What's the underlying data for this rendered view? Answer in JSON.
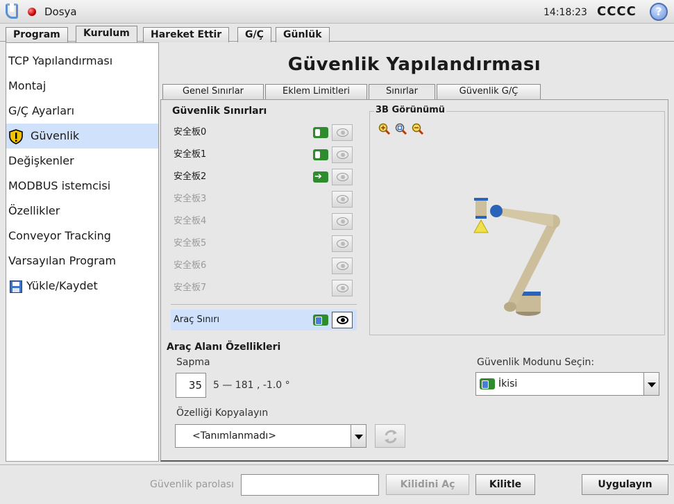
{
  "topbar": {
    "file_menu": "Dosya",
    "time": "14:18:23",
    "robot_name": "CCCC",
    "help": "?"
  },
  "main_tabs": [
    "Program",
    "Kurulum",
    "Hareket Ettir",
    "G/Ç",
    "Günlük"
  ],
  "sidebar": {
    "items": [
      {
        "label": "TCP Yapılandırması"
      },
      {
        "label": "Montaj"
      },
      {
        "label": "G/Ç Ayarları"
      },
      {
        "label": "Güvenlik"
      },
      {
        "label": "Değişkenler"
      },
      {
        "label": "MODBUS istemcisi"
      },
      {
        "label": "Özellikler"
      },
      {
        "label": "Conveyor Tracking"
      },
      {
        "label": "Varsayılan Program"
      },
      {
        "label": "Yükle/Kaydet"
      }
    ]
  },
  "page": {
    "title": "Güvenlik Yapılandırması",
    "sub_tabs": [
      "Genel Sınırlar",
      "Eklem Limitleri",
      "Sınırlar",
      "Güvenlik G/Ç"
    ]
  },
  "boundaries": {
    "title": "Güvenlik Sınırları",
    "planes": [
      {
        "label": "安全板0",
        "state": "on"
      },
      {
        "label": "安全板1",
        "state": "on"
      },
      {
        "label": "安全板2",
        "state": "trigger"
      },
      {
        "label": "安全板3",
        "state": "disabled"
      },
      {
        "label": "安全板4",
        "state": "disabled"
      },
      {
        "label": "安全板5",
        "state": "disabled"
      },
      {
        "label": "安全板6",
        "state": "disabled"
      },
      {
        "label": "安全板7",
        "state": "disabled"
      }
    ],
    "tool_boundary": "Araç Sınırı"
  },
  "view3d": {
    "title": "3B Görünümü",
    "zoom_icons": [
      "zoom-in-icon",
      "zoom-fit-icon",
      "zoom-out-icon"
    ]
  },
  "tool_area": {
    "title": "Araç Alanı Özellikleri",
    "deviation_label": "Sapma",
    "deviation_value": "35",
    "deviation_range": "5 — 181 , -1.0 °",
    "copy_label": "Özelliği Kopyalayın",
    "copy_value": "<Tanımlanmadı>",
    "mode_label": "Güvenlik Modunu Seçin:",
    "mode_value": "İkisi"
  },
  "bottom": {
    "password_label": "Güvenlik parolası",
    "password_value": "",
    "unlock": "Kilidini Aç",
    "lock": "Kilitle",
    "apply": "Uygulayın"
  }
}
